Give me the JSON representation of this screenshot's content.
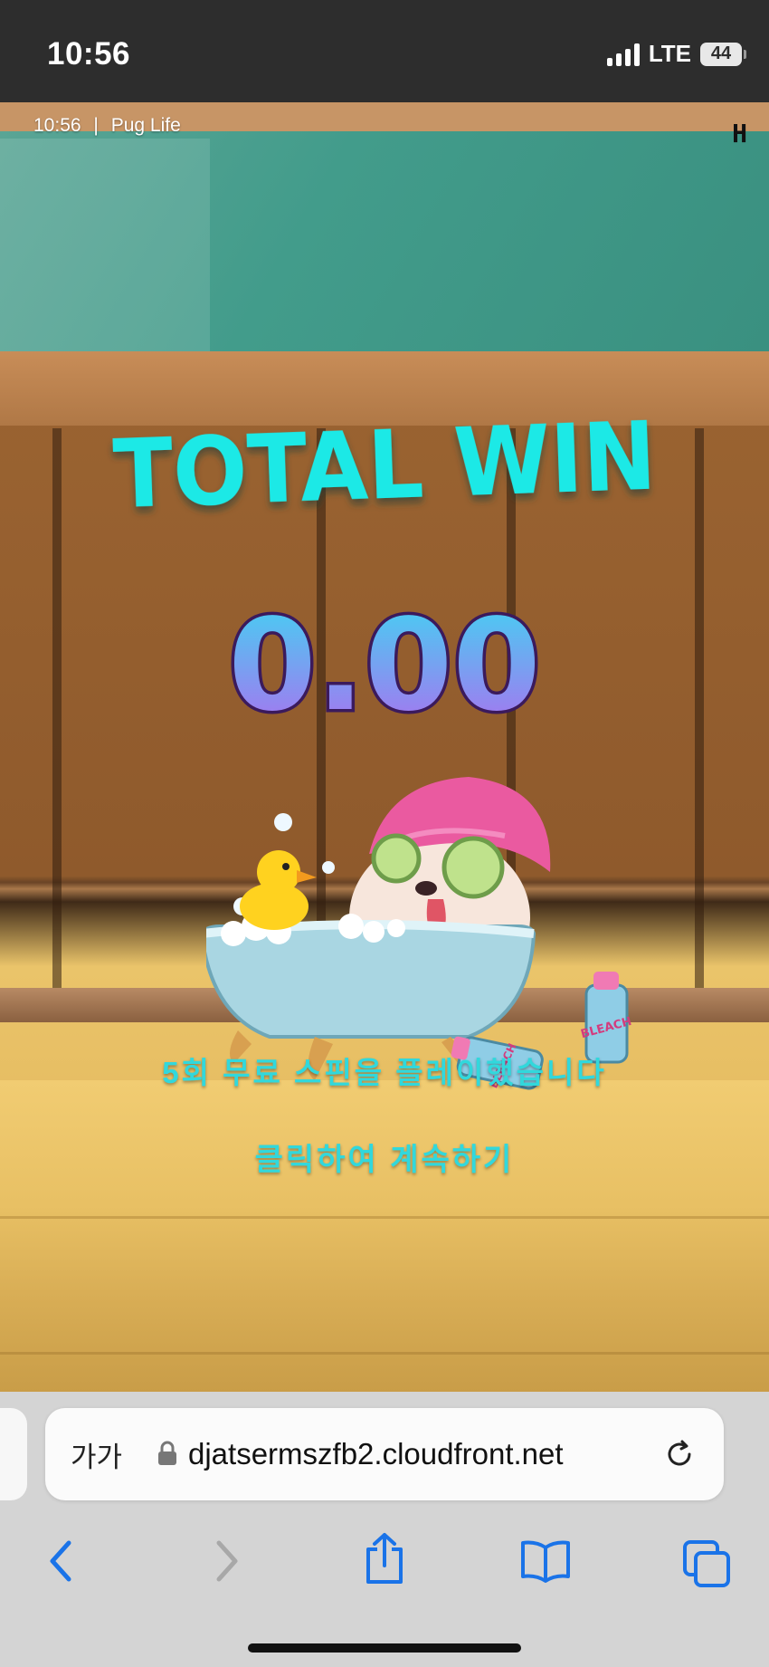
{
  "status_bar": {
    "time": "10:56",
    "network": "LTE",
    "battery": "44"
  },
  "game": {
    "info_time": "10:56",
    "info_separator": "|",
    "info_title": "Pug Life",
    "logo": "H",
    "total_win_label": "TOTAL WIN",
    "win_amount": "0.00",
    "free_spins_message": "5회 무료 스핀을 플레이했습니다",
    "continue_message": "클릭하여 계속하기",
    "bottle_label": "BLEACH",
    "accent_color": "#1de9e6",
    "amount_color_top": "#3ed6f2",
    "amount_color_bottom": "#b06cf0"
  },
  "browser": {
    "text_size_button": "가가",
    "url": "djatsermszfb2.cloudfront.net",
    "toolbar_icons": [
      "back-icon",
      "forward-icon",
      "share-icon",
      "bookmarks-icon",
      "tabs-icon"
    ]
  }
}
